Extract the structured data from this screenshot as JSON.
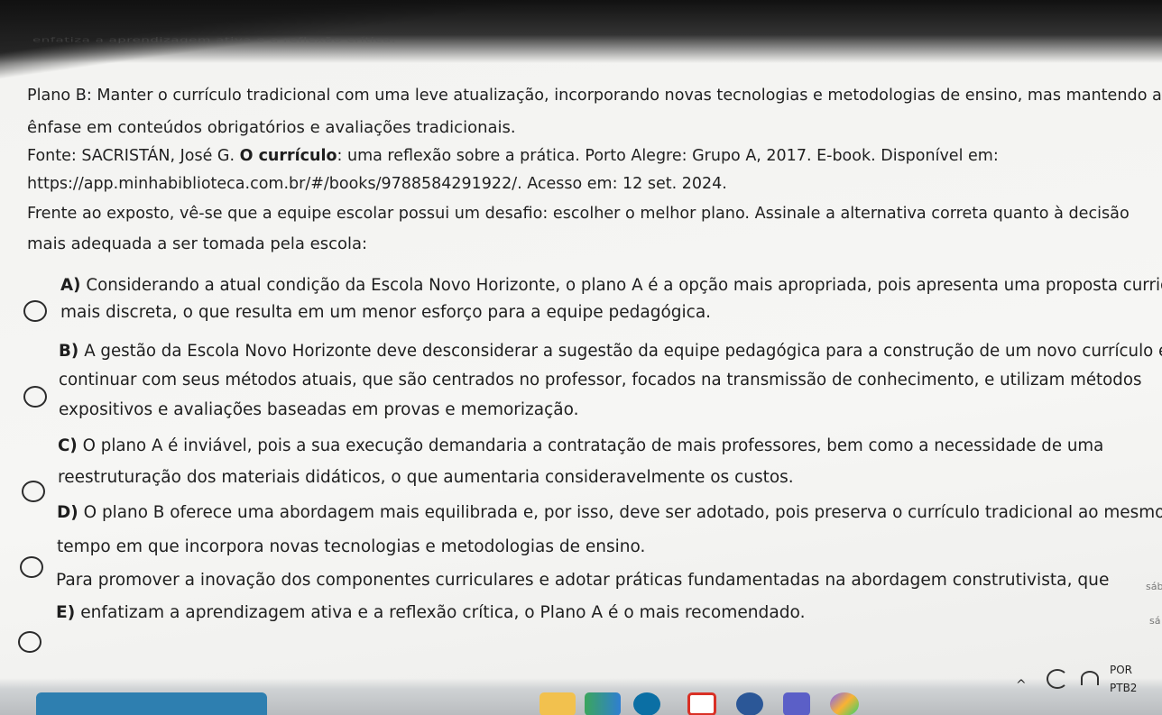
{
  "document": {
    "cut_line": "enfatiza a aprendizagem ativa e a reflexão crítica.",
    "plan_b_line1": "Plano B: Manter o currículo tradicional com uma leve atualização, incorporando novas tecnologias e metodologias de ensino, mas mantendo a",
    "plan_b_line2": "ênfase em conteúdos obrigatórios e avaliações tradicionais.",
    "source_prefix": "Fonte: SACRISTÁN, José G. ",
    "source_title": "O currículo",
    "source_suffix": ": uma reflexão sobre a prática. Porto Alegre: Grupo A, 2017. E-book. Disponível em:",
    "source_url": "https://app.minhabiblioteca.com.br/#/books/9788584291922/. Acesso em: 12 set. 2024.",
    "question_line1": "Frente ao exposto, vê-se que a equipe escolar possui um desafio: escolher o melhor plano. Assinale a alternativa correta quanto à decisão",
    "question_line2": "mais adequada a ser tomada pela escola:"
  },
  "options": [
    {
      "letter": "A)",
      "line1": "Considerando a atual condição da Escola Novo Horizonte, o plano A é a opção mais apropriada, pois apresenta uma proposta curricular",
      "line2": "mais discreta, o que resulta em um menor esforço para a equipe pedagógica."
    },
    {
      "letter": "B)",
      "line1": "A gestão da Escola Novo Horizonte deve desconsiderar a sugestão da equipe pedagógica para a construção de um novo currículo e",
      "line2": "continuar com seus métodos atuais, que são centrados no professor, focados na transmissão de conhecimento, e utilizam métodos",
      "line3": "expositivos e avaliações baseadas em provas e memorização."
    },
    {
      "letter": "C)",
      "line1": "O plano A é inviável, pois a sua execução demandaria a contratação de mais professores, bem como a necessidade de uma",
      "line2": "reestruturação dos materiais didáticos, o que aumentaria consideravelmente os custos."
    },
    {
      "letter": "D)",
      "line1": "O plano B oferece uma abordagem mais equilibrada e, por isso, deve ser adotado, pois preserva o currículo tradicional ao mesmo",
      "line2": "tempo em que incorpora novas tecnologias e metodologias de ensino."
    },
    {
      "letter": "E)",
      "line1": "Para promover a inovação dos componentes curriculares e adotar práticas fundamentadas na abordagem construtivista, que",
      "line2": "enfatizam a aprendizagem ativa e a reflexão crítica, o Plano A é o mais recomendado."
    }
  ],
  "side_fragments": {
    "frag1": "sáb",
    "frag2": "sá"
  },
  "taskbar": {
    "lang_line1": "POR",
    "lang_line2": "PTB2",
    "chevron": "^",
    "accent_colors": {
      "start_button": "#2e7fb0",
      "gmail": "#d93025",
      "teams": "#5b5fc7",
      "copilot": "#7b61ff",
      "dell": "#0b6fa4"
    }
  }
}
